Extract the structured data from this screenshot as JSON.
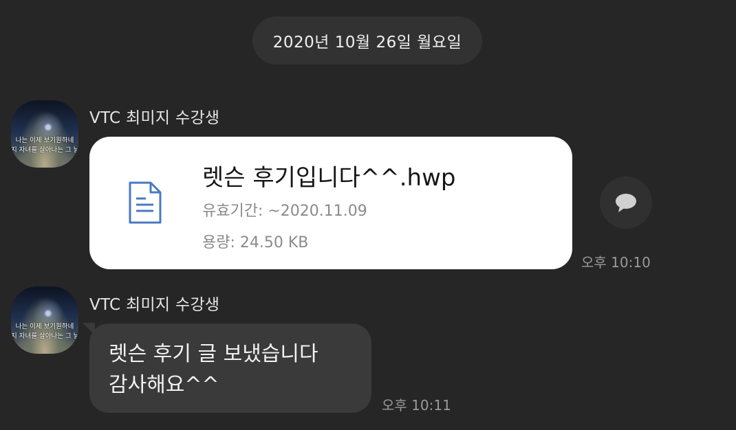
{
  "date_divider": "2020년 10월 26일 월요일",
  "messages": [
    {
      "sender": "VTC 최미지 수강생",
      "avatar_caption": [
        "나는 이제 보기원하네",
        "지 자녀를 살아나는 그 날"
      ],
      "file": {
        "name": "렛슨 후기입니다^^.hwp",
        "expiry": "유효기간: ~2020.11.09",
        "size": "용량: 24.50 KB",
        "icon": "document-icon"
      },
      "time": "오후 10:10",
      "comment_icon": "speech-bubble-icon"
    },
    {
      "sender": "VTC 최미지 수강생",
      "avatar_caption": [
        "나는 이제 보기원하네",
        "지 자녀를 살아나는 그 날"
      ],
      "text_lines": [
        "렛슨 후기 글 보냈습니다",
        "감사해요^^"
      ],
      "time": "오후 10:11"
    }
  ],
  "colors": {
    "background": "#262626",
    "date_pill": "#323232",
    "file_card": "#ffffff",
    "text_bubble": "#3a3a3a",
    "file_icon": "#4a78c4"
  }
}
